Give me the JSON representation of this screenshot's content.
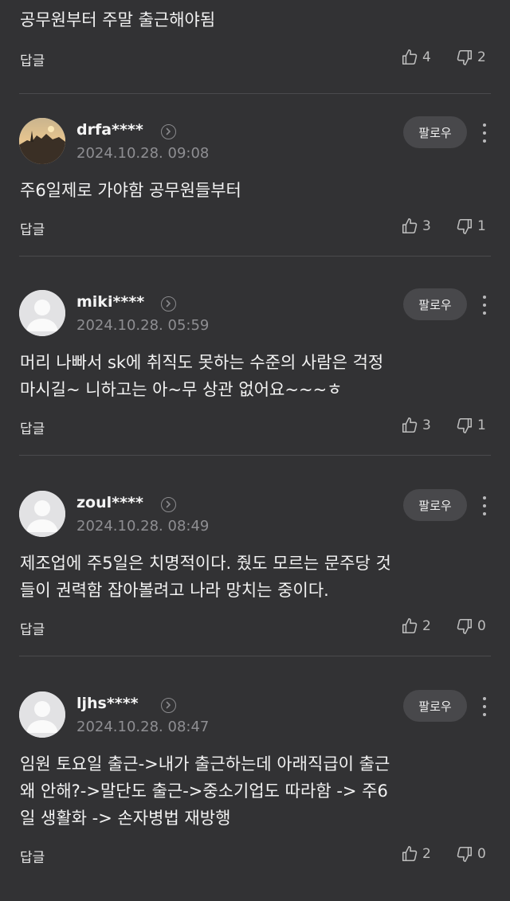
{
  "top": {
    "text": "공무원부터 주말 출근해야됨",
    "reply": "답글",
    "likes": "4",
    "dislikes": "2"
  },
  "follow_label": "팔로우",
  "comments": [
    {
      "username": "drfa****",
      "date": "2024.10.28. 09:08",
      "lines": [
        "주6일제로 가야함 공무원들부터"
      ],
      "reply": "답글",
      "likes": "3",
      "dislikes": "1",
      "avatar": "photo"
    },
    {
      "username": "miki****",
      "date": "2024.10.28. 05:59",
      "lines": [
        "머리 나빠서 sk에 취직도 못하는 수준의 사람은 걱정",
        "마시길~ 니하고는 아~무 상관 없어요~~~ㅎ"
      ],
      "reply": "답글",
      "likes": "3",
      "dislikes": "1",
      "avatar": "default"
    },
    {
      "username": "zoul****",
      "date": "2024.10.28. 08:49",
      "lines": [
        "제조업에 주5일은 치명적이다. 줬도 모르는 문주당 것",
        "들이 권력함 잡아볼려고 나라 망치는 중이다."
      ],
      "reply": "답글",
      "likes": "2",
      "dislikes": "0",
      "avatar": "default"
    },
    {
      "username": "ljhs****",
      "date": "2024.10.28. 08:47",
      "lines": [
        "임원 토요일 출근->내가 출근하는데 아래직급이 출근",
        "왜 안해?->말단도 출근->중소기업도 따라함 -> 주6",
        "일 생활화 -> 손자병법 재방행"
      ],
      "reply": "답글",
      "likes": "2",
      "dislikes": "0",
      "avatar": "default"
    }
  ]
}
